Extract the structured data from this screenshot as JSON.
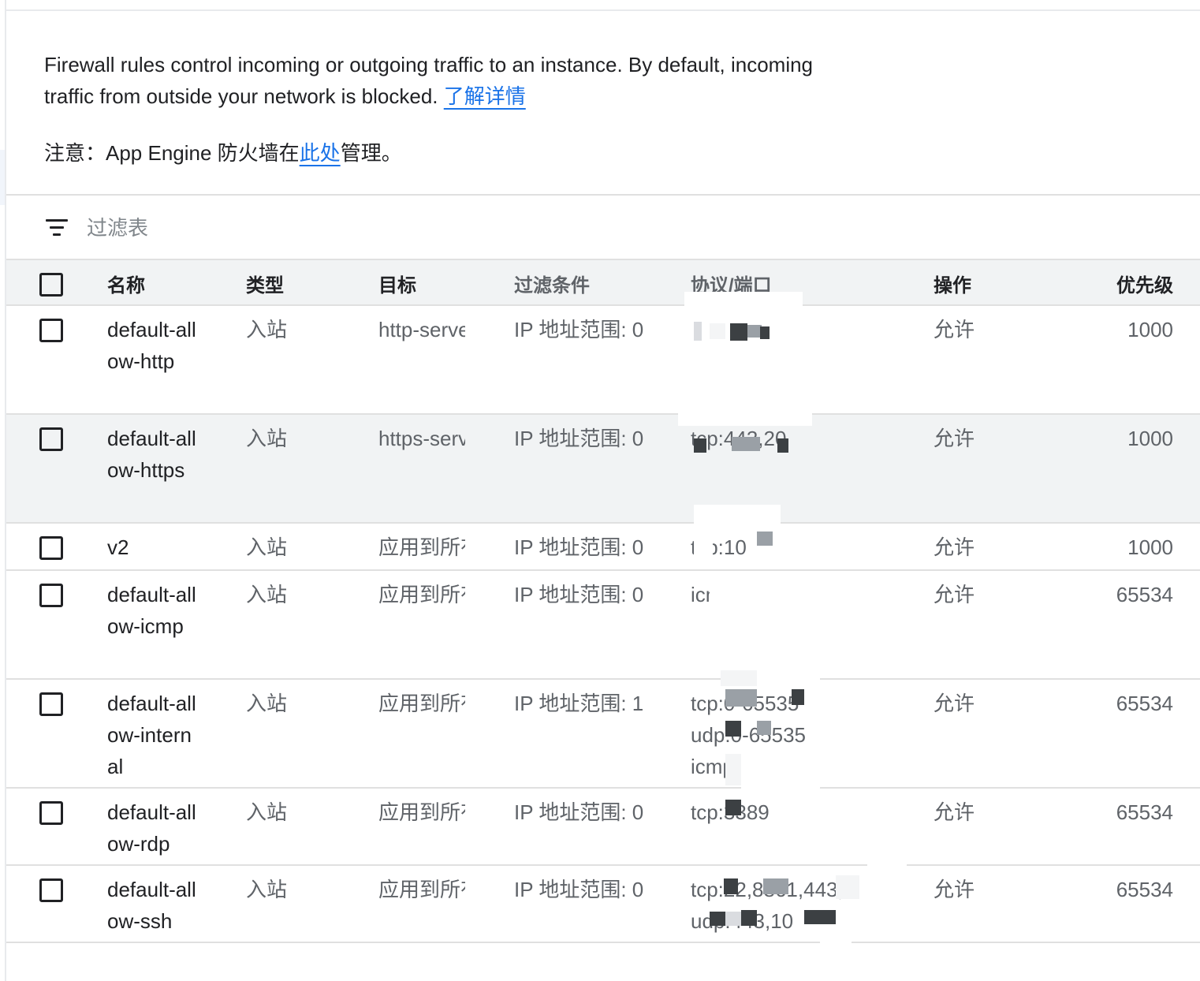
{
  "intro": {
    "text": "Firewall rules control incoming or outgoing traffic to an instance. By default, incoming traffic from outside your network is blocked.",
    "learn_more": "了解详情"
  },
  "note": {
    "prefix": "注意：App Engine 防火墙在",
    "link": "此处",
    "suffix": "管理。"
  },
  "filter": {
    "placeholder": "过滤表",
    "icon": "filter-list-icon"
  },
  "table": {
    "headers": {
      "name": "名称",
      "type": "类型",
      "target": "目标",
      "filter": "过滤条件",
      "protocol": "协议/端口",
      "action": "操作",
      "priority": "优先级"
    },
    "rows": [
      {
        "name": "default-allow-http",
        "type": "入站",
        "target": "http-server",
        "filter": "IP 地址范围: 0",
        "protocol": "tcp:80",
        "action": "允许",
        "priority": "1000"
      },
      {
        "name": "default-allow-https",
        "type": "入站",
        "target": "https-server",
        "filter": "IP 地址范围: 0",
        "protocol": "tcp:443,20",
        "action": "允许",
        "priority": "1000"
      },
      {
        "name": "v2",
        "type": "入站",
        "target": "应用到所有",
        "filter": "IP 地址范围: 0",
        "protocol": "tcp:10",
        "action": "允许",
        "priority": "1000"
      },
      {
        "name": "default-allow-icmp",
        "type": "入站",
        "target": "应用到所有",
        "filter": "IP 地址范围: 0",
        "protocol": "icmp",
        "action": "允许",
        "priority": "65534"
      },
      {
        "name": "default-allow-internal",
        "type": "入站",
        "target": "应用到所有",
        "filter": "IP 地址范围: 1",
        "protocol": "tcp:0-65535\nudp:0-65535\nicmp",
        "action": "允许",
        "priority": "65534"
      },
      {
        "name": "default-allow-rdp",
        "type": "入站",
        "target": "应用到所有",
        "filter": "IP 地址范围: 0",
        "protocol": "tcp:3389",
        "action": "允许",
        "priority": "65534"
      },
      {
        "name": "default-allow-ssh",
        "type": "入站",
        "target": "应用到所有",
        "filter": "IP 地址范围: 0",
        "protocol": "tcp:22,8861,443,\nudp:443,10",
        "action": "允许",
        "priority": "65534"
      }
    ]
  }
}
